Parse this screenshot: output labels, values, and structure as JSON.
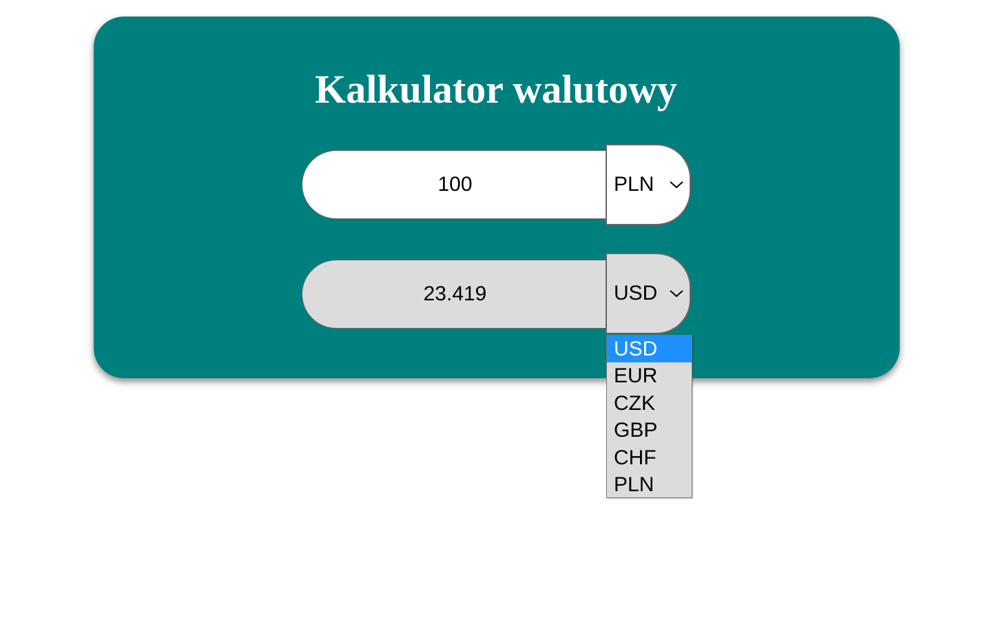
{
  "app": {
    "title": "Kalkulator walutowy"
  },
  "from": {
    "amount": "100",
    "currency": "PLN"
  },
  "to": {
    "amount": "23.419",
    "currency": "USD"
  },
  "dropdown": {
    "options": [
      "USD",
      "EUR",
      "CZK",
      "GBP",
      "CHF",
      "PLN"
    ],
    "selected": "USD"
  },
  "colors": {
    "card": "#007f7f",
    "selected_option": "#1e90ff",
    "disabled_field": "#dcdcdc"
  },
  "icons": {
    "select_arrow": "chevron-down-icon"
  }
}
